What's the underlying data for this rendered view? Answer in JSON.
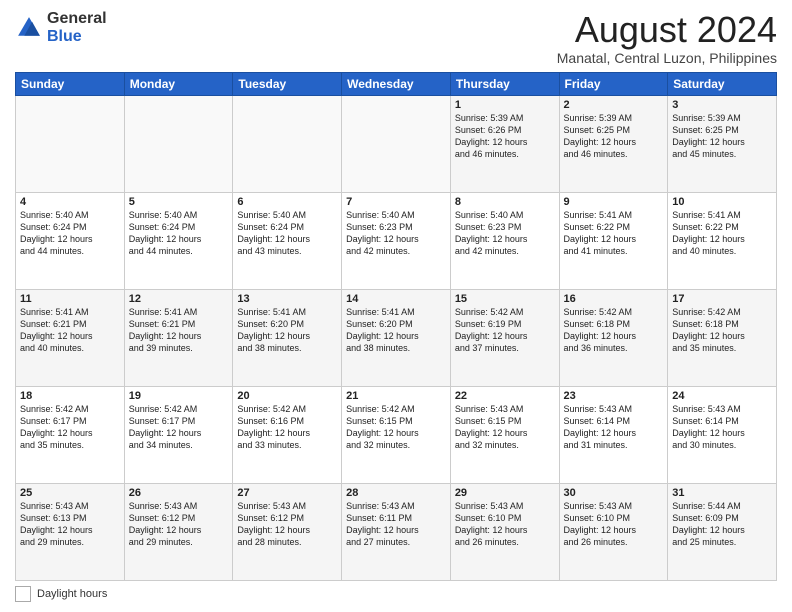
{
  "header": {
    "logo_general": "General",
    "logo_blue": "Blue",
    "main_title": "August 2024",
    "subtitle": "Manatal, Central Luzon, Philippines"
  },
  "days_of_week": [
    "Sunday",
    "Monday",
    "Tuesday",
    "Wednesday",
    "Thursday",
    "Friday",
    "Saturday"
  ],
  "weeks": [
    [
      {
        "day": "",
        "info": ""
      },
      {
        "day": "",
        "info": ""
      },
      {
        "day": "",
        "info": ""
      },
      {
        "day": "",
        "info": ""
      },
      {
        "day": "1",
        "info": "Sunrise: 5:39 AM\nSunset: 6:26 PM\nDaylight: 12 hours\nand 46 minutes."
      },
      {
        "day": "2",
        "info": "Sunrise: 5:39 AM\nSunset: 6:25 PM\nDaylight: 12 hours\nand 46 minutes."
      },
      {
        "day": "3",
        "info": "Sunrise: 5:39 AM\nSunset: 6:25 PM\nDaylight: 12 hours\nand 45 minutes."
      }
    ],
    [
      {
        "day": "4",
        "info": "Sunrise: 5:40 AM\nSunset: 6:24 PM\nDaylight: 12 hours\nand 44 minutes."
      },
      {
        "day": "5",
        "info": "Sunrise: 5:40 AM\nSunset: 6:24 PM\nDaylight: 12 hours\nand 44 minutes."
      },
      {
        "day": "6",
        "info": "Sunrise: 5:40 AM\nSunset: 6:24 PM\nDaylight: 12 hours\nand 43 minutes."
      },
      {
        "day": "7",
        "info": "Sunrise: 5:40 AM\nSunset: 6:23 PM\nDaylight: 12 hours\nand 42 minutes."
      },
      {
        "day": "8",
        "info": "Sunrise: 5:40 AM\nSunset: 6:23 PM\nDaylight: 12 hours\nand 42 minutes."
      },
      {
        "day": "9",
        "info": "Sunrise: 5:41 AM\nSunset: 6:22 PM\nDaylight: 12 hours\nand 41 minutes."
      },
      {
        "day": "10",
        "info": "Sunrise: 5:41 AM\nSunset: 6:22 PM\nDaylight: 12 hours\nand 40 minutes."
      }
    ],
    [
      {
        "day": "11",
        "info": "Sunrise: 5:41 AM\nSunset: 6:21 PM\nDaylight: 12 hours\nand 40 minutes."
      },
      {
        "day": "12",
        "info": "Sunrise: 5:41 AM\nSunset: 6:21 PM\nDaylight: 12 hours\nand 39 minutes."
      },
      {
        "day": "13",
        "info": "Sunrise: 5:41 AM\nSunset: 6:20 PM\nDaylight: 12 hours\nand 38 minutes."
      },
      {
        "day": "14",
        "info": "Sunrise: 5:41 AM\nSunset: 6:20 PM\nDaylight: 12 hours\nand 38 minutes."
      },
      {
        "day": "15",
        "info": "Sunrise: 5:42 AM\nSunset: 6:19 PM\nDaylight: 12 hours\nand 37 minutes."
      },
      {
        "day": "16",
        "info": "Sunrise: 5:42 AM\nSunset: 6:18 PM\nDaylight: 12 hours\nand 36 minutes."
      },
      {
        "day": "17",
        "info": "Sunrise: 5:42 AM\nSunset: 6:18 PM\nDaylight: 12 hours\nand 35 minutes."
      }
    ],
    [
      {
        "day": "18",
        "info": "Sunrise: 5:42 AM\nSunset: 6:17 PM\nDaylight: 12 hours\nand 35 minutes."
      },
      {
        "day": "19",
        "info": "Sunrise: 5:42 AM\nSunset: 6:17 PM\nDaylight: 12 hours\nand 34 minutes."
      },
      {
        "day": "20",
        "info": "Sunrise: 5:42 AM\nSunset: 6:16 PM\nDaylight: 12 hours\nand 33 minutes."
      },
      {
        "day": "21",
        "info": "Sunrise: 5:42 AM\nSunset: 6:15 PM\nDaylight: 12 hours\nand 32 minutes."
      },
      {
        "day": "22",
        "info": "Sunrise: 5:43 AM\nSunset: 6:15 PM\nDaylight: 12 hours\nand 32 minutes."
      },
      {
        "day": "23",
        "info": "Sunrise: 5:43 AM\nSunset: 6:14 PM\nDaylight: 12 hours\nand 31 minutes."
      },
      {
        "day": "24",
        "info": "Sunrise: 5:43 AM\nSunset: 6:14 PM\nDaylight: 12 hours\nand 30 minutes."
      }
    ],
    [
      {
        "day": "25",
        "info": "Sunrise: 5:43 AM\nSunset: 6:13 PM\nDaylight: 12 hours\nand 29 minutes."
      },
      {
        "day": "26",
        "info": "Sunrise: 5:43 AM\nSunset: 6:12 PM\nDaylight: 12 hours\nand 29 minutes."
      },
      {
        "day": "27",
        "info": "Sunrise: 5:43 AM\nSunset: 6:12 PM\nDaylight: 12 hours\nand 28 minutes."
      },
      {
        "day": "28",
        "info": "Sunrise: 5:43 AM\nSunset: 6:11 PM\nDaylight: 12 hours\nand 27 minutes."
      },
      {
        "day": "29",
        "info": "Sunrise: 5:43 AM\nSunset: 6:10 PM\nDaylight: 12 hours\nand 26 minutes."
      },
      {
        "day": "30",
        "info": "Sunrise: 5:43 AM\nSunset: 6:10 PM\nDaylight: 12 hours\nand 26 minutes."
      },
      {
        "day": "31",
        "info": "Sunrise: 5:44 AM\nSunset: 6:09 PM\nDaylight: 12 hours\nand 25 minutes."
      }
    ]
  ],
  "footer": {
    "daylight_label": "Daylight hours"
  }
}
